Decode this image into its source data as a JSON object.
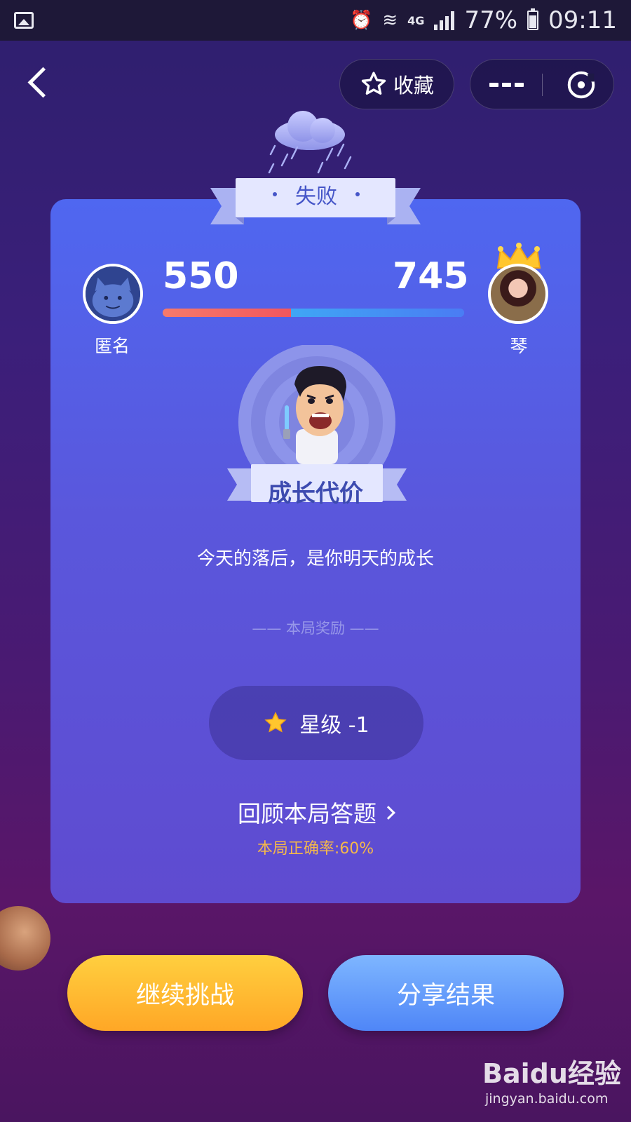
{
  "status_bar": {
    "network": "4G",
    "battery": "77%",
    "time": "09:11"
  },
  "nav": {
    "favorite_label": "收藏"
  },
  "result": {
    "ribbon_label": "失败",
    "player_left": {
      "name": "匿名",
      "score": "550"
    },
    "player_right": {
      "name": "琴",
      "score": "745"
    },
    "score_share_left": 0.425,
    "badge_title": "成长代价",
    "motto": "今天的落后，是你明天的成长",
    "reward_title": "—— 本局奖励 ——",
    "reward_value": "星级 -1",
    "review_label": "回顾本局答题",
    "accuracy": "本局正确率:60%"
  },
  "actions": {
    "continue_label": "继续挑战",
    "share_label": "分享结果"
  },
  "watermark": {
    "logo": "Baidu经验",
    "url": "jingyan.baidu.com"
  },
  "colors": {
    "accent_orange": "#ffa726",
    "accent_blue": "#4f86f7",
    "card_blue": "#5a57dc",
    "accuracy_gold": "#f5b84a"
  }
}
